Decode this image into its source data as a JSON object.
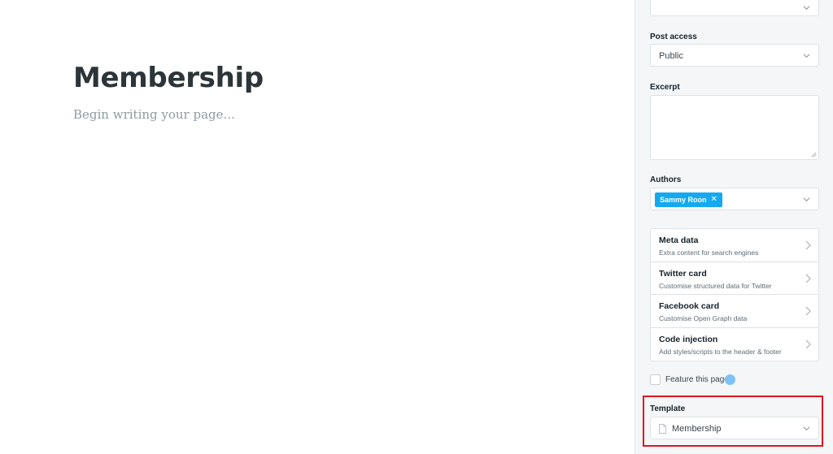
{
  "editor": {
    "title": "Membership",
    "body_placeholder": "Begin writing your page..."
  },
  "sidebar": {
    "post_access": {
      "label": "Post access",
      "value": "Public"
    },
    "excerpt": {
      "label": "Excerpt",
      "value": ""
    },
    "authors": {
      "label": "Authors",
      "tokens": [
        "Sammy Roon"
      ]
    },
    "menu": [
      {
        "title": "Meta data",
        "subtitle": "Extra content for search engines"
      },
      {
        "title": "Twitter card",
        "subtitle": "Customise structured data for Twitter"
      },
      {
        "title": "Facebook card",
        "subtitle": "Customise Open Graph data"
      },
      {
        "title": "Code injection",
        "subtitle": "Add styles/scripts to the header & footer"
      }
    ],
    "feature": {
      "label": "Feature this page",
      "checked": false
    },
    "template": {
      "label": "Template",
      "value": "Membership",
      "icon": "document-icon"
    }
  },
  "colors": {
    "accent": "#14a9f0",
    "highlight": "#e0161f",
    "sidebar_bg": "#f4f6f8"
  }
}
